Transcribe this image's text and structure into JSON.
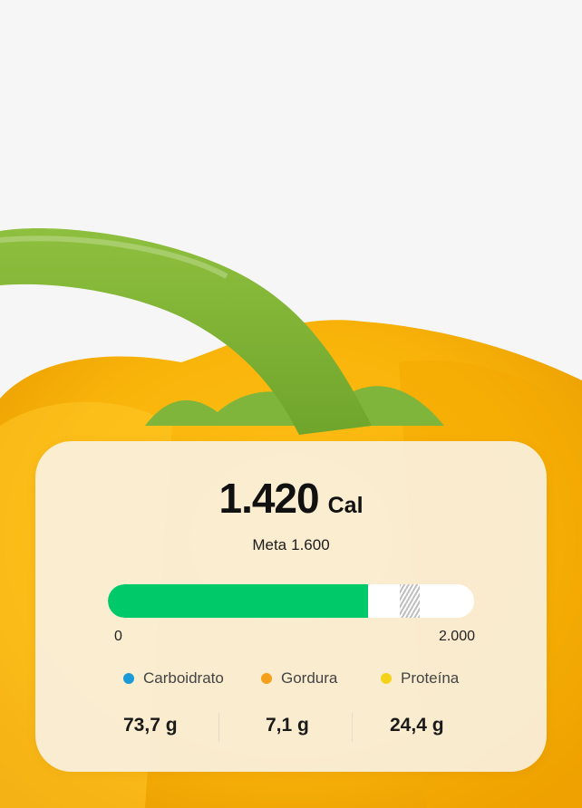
{
  "calories": {
    "value": "1.420",
    "unit": "Cal",
    "goal_label": "Meta",
    "goal_value": "1.600"
  },
  "progress": {
    "current": 1420,
    "goal": 1600,
    "max": 2000,
    "min_label": "0",
    "max_label": "2.000",
    "fill_color": "#00c96a"
  },
  "macros": [
    {
      "label": "Carboidrato",
      "value": "73,7 g",
      "color": "#1a9ad6"
    },
    {
      "label": "Gordura",
      "value": "7,1 g",
      "color": "#f5a01a"
    },
    {
      "label": "Proteína",
      "value": "24,4 g",
      "color": "#f5d21a"
    }
  ]
}
